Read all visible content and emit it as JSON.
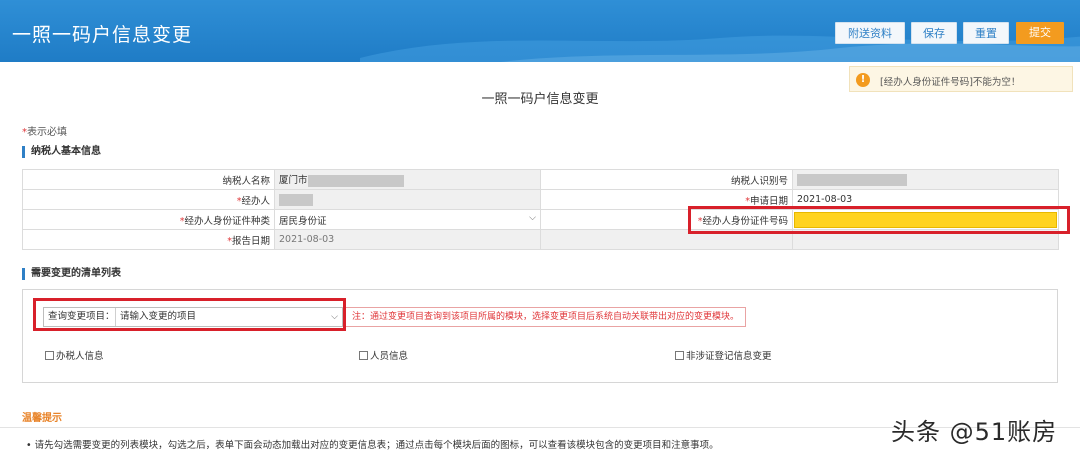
{
  "header": {
    "title": "一照一码户信息变更",
    "buttons": {
      "attach": "附送资料",
      "save": "保存",
      "reset": "重置",
      "submit": "提交"
    }
  },
  "alert": {
    "icon": "warning-icon",
    "text": "[经办人身份证件号码]不能为空！"
  },
  "page_title": "一照一码户信息变更",
  "required_note": "表示必填",
  "required_star": "*",
  "section_basic": {
    "title": "纳税人基本信息"
  },
  "basic_info": {
    "taxpayer_name_label": "纳税人名称",
    "taxpayer_name_value": "厦门市",
    "taxpayer_id_label": "纳税人识别号",
    "agent_label": "经办人",
    "apply_date_label": "申请日期",
    "apply_date_value": "2021-08-03",
    "id_type_label": "经办人身份证件种类",
    "id_type_value": "居民身份证",
    "id_number_label": "经办人身份证件号码",
    "report_date_label": "报告日期",
    "report_date_value": "2021-08-03"
  },
  "section_list": {
    "title": "需要变更的清单列表"
  },
  "query": {
    "label": "查询变更项目：",
    "placeholder": "请输入变更的项目",
    "note": "注：通过变更项目查询到该项目所属的模块，选择变更项目后系统自动关联带出对应的变更模块。"
  },
  "checkboxes": [
    "办税人信息",
    "人员信息",
    "非涉证登记信息变更"
  ],
  "tips": {
    "title": "温馨提示",
    "text": "• 请先勾选需要变更的列表模块，勾选之后，表单下面会动态加载出对应的变更信息表；通过点击每个模块后面的图标，可以查看该模块包含的变更项目和注意事项。"
  },
  "watermark": "头条 @51账房",
  "colors": {
    "header_blue": "#1f7cc6",
    "submit_orange": "#f39b1f",
    "highlight_red": "#d8202a",
    "required_yellow": "#ffd320"
  }
}
